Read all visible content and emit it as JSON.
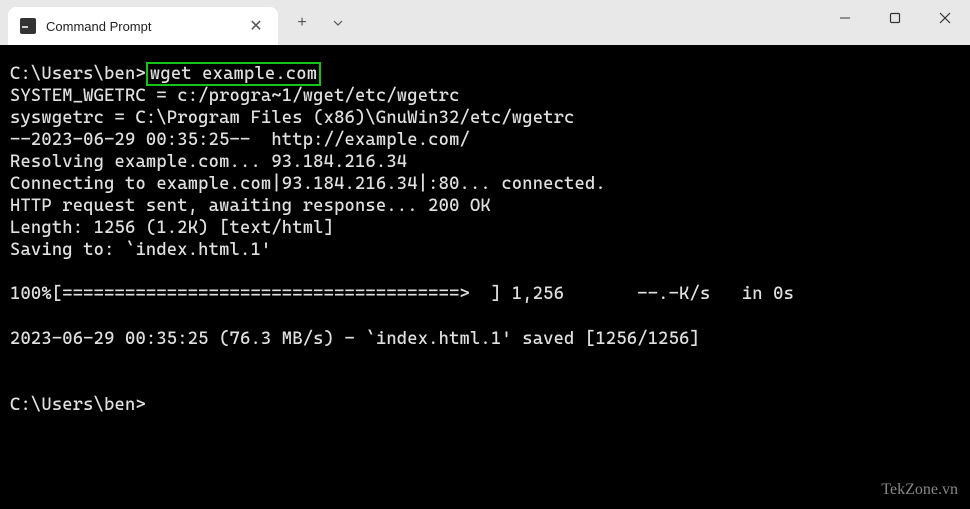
{
  "titlebar": {
    "tab_title": "Command Prompt",
    "close_glyph": "✕",
    "new_tab_glyph": "+"
  },
  "terminal": {
    "prompt1_prefix": "C:\\Users\\ben>",
    "command": "wget example.com",
    "line_system_wgetrc": "SYSTEM_WGETRC = c:/progra~1/wget/etc/wgetrc",
    "line_syswgetrc": "syswgetrc = C:\\Program Files (x86)\\GnuWin32/etc/wgetrc",
    "line_ts_url": "--2023-06-29 00:35:25--  http://example.com/",
    "line_resolving": "Resolving example.com... 93.184.216.34",
    "line_connecting": "Connecting to example.com|93.184.216.34|:80... connected.",
    "line_http": "HTTP request sent, awaiting response... 200 OK",
    "line_length": "Length: 1256 (1.2K) [text/html]",
    "line_saving": "Saving to: `index.html.1'",
    "blank": "",
    "line_progress": "100%[======================================>  ] 1,256       --.-K/s   in 0s",
    "line_saved": "2023-06-29 00:35:25 (76.3 MB/s) - `index.html.1' saved [1256/1256]",
    "prompt2": "C:\\Users\\ben>"
  },
  "watermark": "TekZone.vn"
}
